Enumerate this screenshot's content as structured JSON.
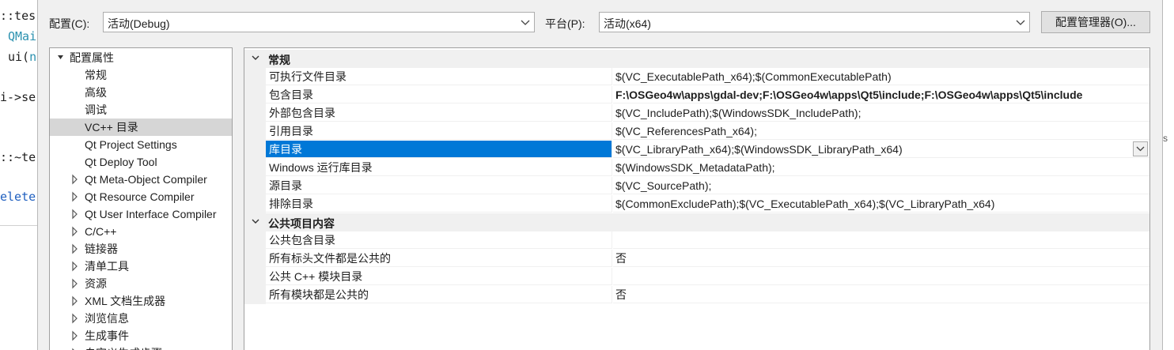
{
  "background_code": {
    "lines": [
      {
        "prefix": "::tes",
        "rest": ""
      },
      {
        "prefix": "QMai",
        "rest": ""
      },
      {
        "prefix": "ui(",
        "rest": "n"
      },
      {
        "prefix": "i->se",
        "rest": ""
      },
      {
        "prefix": "::~te",
        "rest": ""
      },
      {
        "prefix": "elete",
        "rest": ""
      }
    ]
  },
  "header": {
    "config_label": "配置(C):",
    "config_value": "活动(Debug)",
    "platform_label": "平台(P):",
    "platform_value": "活动(x64)",
    "config_manager_label": "配置管理器(O)..."
  },
  "tree": {
    "root": "配置属性",
    "items": [
      {
        "label": "常规",
        "expandable": false
      },
      {
        "label": "高级",
        "expandable": false
      },
      {
        "label": "调试",
        "expandable": false
      },
      {
        "label": "VC++ 目录",
        "expandable": false,
        "selected": true
      },
      {
        "label": "Qt Project Settings",
        "expandable": false
      },
      {
        "label": "Qt Deploy Tool",
        "expandable": false
      },
      {
        "label": "Qt Meta-Object Compiler",
        "expandable": true
      },
      {
        "label": "Qt Resource Compiler",
        "expandable": true
      },
      {
        "label": "Qt User Interface Compiler",
        "expandable": true
      },
      {
        "label": "C/C++",
        "expandable": true
      },
      {
        "label": "链接器",
        "expandable": true
      },
      {
        "label": "清单工具",
        "expandable": true
      },
      {
        "label": "资源",
        "expandable": true
      },
      {
        "label": "XML 文档生成器",
        "expandable": true
      },
      {
        "label": "浏览信息",
        "expandable": true
      },
      {
        "label": "生成事件",
        "expandable": true
      },
      {
        "label": "自定义生成步骤",
        "expandable": true
      }
    ]
  },
  "grid": {
    "categories": [
      {
        "title": "常规",
        "rows": [
          {
            "name": "可执行文件目录",
            "value": "$(VC_ExecutablePath_x64);$(CommonExecutablePath)"
          },
          {
            "name": "包含目录",
            "value": "F:\\OSGeo4w\\apps\\gdal-dev;F:\\OSGeo4w\\apps\\Qt5\\include;F:\\OSGeo4w\\apps\\Qt5\\include",
            "bold": true
          },
          {
            "name": "外部包含目录",
            "value": "$(VC_IncludePath);$(WindowsSDK_IncludePath);"
          },
          {
            "name": "引用目录",
            "value": "$(VC_ReferencesPath_x64);"
          },
          {
            "name": "库目录",
            "value": "$(VC_LibraryPath_x64);$(WindowsSDK_LibraryPath_x64)",
            "selected": true
          },
          {
            "name": "Windows 运行库目录",
            "value": "$(WindowsSDK_MetadataPath);"
          },
          {
            "name": "源目录",
            "value": "$(VC_SourcePath);"
          },
          {
            "name": "排除目录",
            "value": "$(CommonExcludePath);$(VC_ExecutablePath_x64);$(VC_LibraryPath_x64)"
          }
        ]
      },
      {
        "title": "公共项目内容",
        "rows": [
          {
            "name": "公共包含目录",
            "value": ""
          },
          {
            "name": "所有标头文件都是公共的",
            "value": "否"
          },
          {
            "name": "公共 C++ 模块目录",
            "value": ""
          },
          {
            "name": "所有模块都是公共的",
            "value": "否"
          }
        ]
      }
    ]
  },
  "colors": {
    "selection_blue": "#0078d7",
    "tree_selection": "#d6d6d6",
    "dialog_bg": "#f0f0f0"
  },
  "icons": [
    "chevron-down-icon",
    "expand-triangle-icon",
    "collapse-triangle-icon"
  ]
}
